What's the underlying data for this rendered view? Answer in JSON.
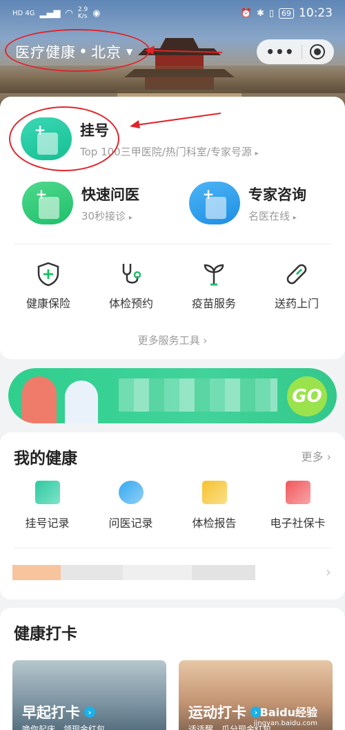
{
  "status_bar": {
    "network": "HD 4G",
    "speed_value": "2.9",
    "speed_unit": "K/s",
    "battery": "69",
    "time": "10:23"
  },
  "header": {
    "location_title": "医疗健康",
    "dot": "•",
    "city": "北京",
    "caret": "▼",
    "capsule_more": "•••"
  },
  "main_services": {
    "register": {
      "title": "挂号",
      "subtitle": "Top 100三甲医院/热门科室/专家号源",
      "chevron": "▸"
    },
    "quick_consult": {
      "title": "快速问医",
      "subtitle": "30秒接诊",
      "chevron": "▸"
    },
    "expert_consult": {
      "title": "专家咨询",
      "subtitle": "名医在线",
      "chevron": "▸"
    }
  },
  "tools": [
    {
      "label": "健康保险",
      "icon": "shield-plus-icon"
    },
    {
      "label": "体检预约",
      "icon": "stethoscope-icon"
    },
    {
      "label": "疫苗服务",
      "icon": "sprout-icon"
    },
    {
      "label": "送药上门",
      "icon": "pill-icon"
    }
  ],
  "more_tools": "更多服务工具 ›",
  "banner": {
    "go": "GO"
  },
  "my_health": {
    "title": "我的健康",
    "more": "更多 ›",
    "records": [
      {
        "label": "挂号记录",
        "icon": "register-record-icon",
        "color": "#2ec9a0"
      },
      {
        "label": "问医记录",
        "icon": "chat-record-icon",
        "color": "#35a8ef"
      },
      {
        "label": "体检报告",
        "icon": "report-icon",
        "color": "#f5c12e"
      },
      {
        "label": "电子社保卡",
        "icon": "social-card-icon",
        "color": "#f0575b"
      }
    ],
    "row_chevron": "›"
  },
  "checkin": {
    "title": "健康打卡",
    "cards": [
      {
        "title": "早起打卡",
        "subtitle": "唤你起床，领现金红包"
      },
      {
        "title": "运动打卡",
        "subtitle": "适适醒，瓜分现金红包"
      }
    ]
  },
  "watermark": {
    "brand": "Baidu经验",
    "url": "jingyan.baidu.com"
  },
  "colors": {
    "accent_green": "#1fbf6a",
    "annotation_red": "#e0242a"
  }
}
